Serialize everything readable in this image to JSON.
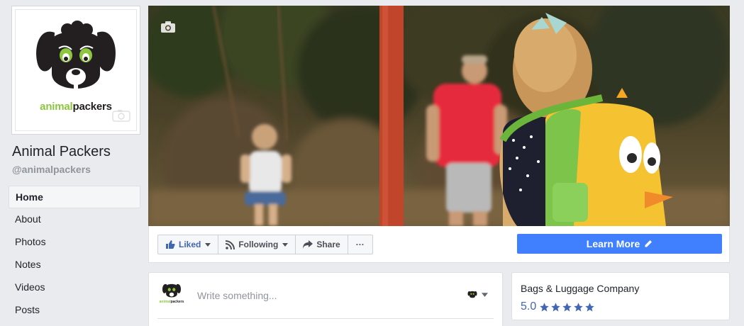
{
  "profile": {
    "logo_text_animal": "animal",
    "logo_text_packers": "packers",
    "page_name": "Animal Packers",
    "handle": "@animalpackers"
  },
  "nav": {
    "items": [
      {
        "label": "Home",
        "active": true
      },
      {
        "label": "About",
        "active": false
      },
      {
        "label": "Photos",
        "active": false
      },
      {
        "label": "Notes",
        "active": false
      },
      {
        "label": "Videos",
        "active": false
      },
      {
        "label": "Posts",
        "active": false
      }
    ]
  },
  "cover": {
    "camera_icon": "camera-icon"
  },
  "actions": {
    "liked_label": "Liked",
    "following_label": "Following",
    "share_label": "Share",
    "more_label": "···",
    "learn_more_label": "Learn More",
    "accent_color": "#4080ff",
    "liked_color": "#4267b2"
  },
  "composer": {
    "placeholder": "Write something...",
    "avatar_text_animal": "animal",
    "avatar_text_packers": "packers"
  },
  "about": {
    "category": "Bags & Luggage Company",
    "rating": "5.0",
    "stars": 5,
    "star_color": "#4267b2"
  }
}
